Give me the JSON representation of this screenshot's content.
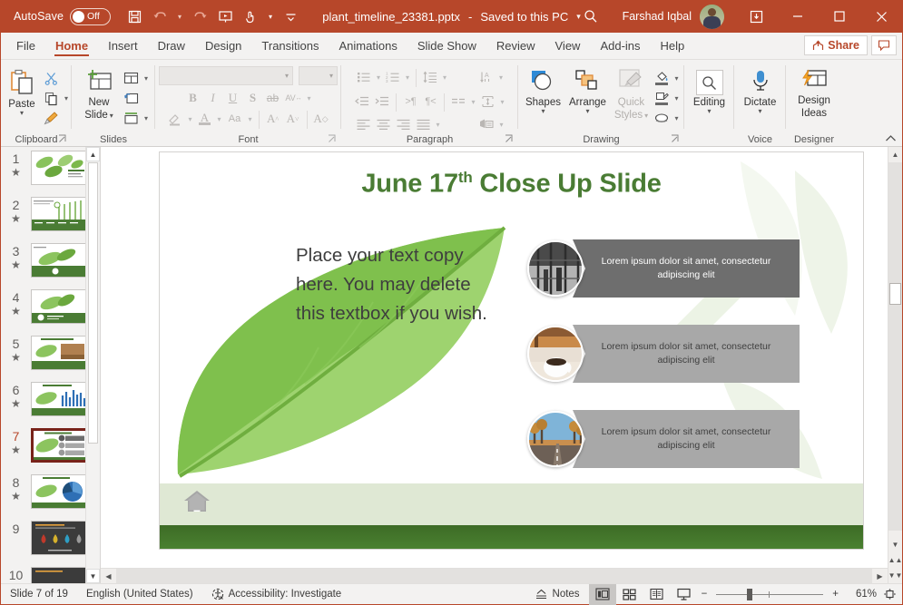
{
  "titlebar": {
    "autosave_label": "AutoSave",
    "autosave_state": "Off",
    "filename": "plant_timeline_23381.pptx",
    "saved_status": "Saved to this PC",
    "caret": "▾",
    "user_name": "Farshad Iqbal",
    "quick_access": [
      "save-icon",
      "undo-icon",
      "redo-icon",
      "start-presentation-icon",
      "touch-mode-icon",
      "customize-qat-icon"
    ],
    "window_controls": [
      "ribbon-display-options",
      "minimize",
      "maximize",
      "close"
    ]
  },
  "tabs": [
    {
      "label": "File",
      "active": false
    },
    {
      "label": "Home",
      "active": true
    },
    {
      "label": "Insert",
      "active": false
    },
    {
      "label": "Draw",
      "active": false
    },
    {
      "label": "Design",
      "active": false
    },
    {
      "label": "Transitions",
      "active": false
    },
    {
      "label": "Animations",
      "active": false
    },
    {
      "label": "Slide Show",
      "active": false
    },
    {
      "label": "Review",
      "active": false
    },
    {
      "label": "View",
      "active": false
    },
    {
      "label": "Add-ins",
      "active": false
    },
    {
      "label": "Help",
      "active": false
    }
  ],
  "share": {
    "label": "Share",
    "comment_icon": "comment-icon"
  },
  "ribbon": {
    "groups": [
      {
        "name": "Clipboard",
        "label": "Clipboard",
        "paste_label": "Paste",
        "has_launcher": true
      },
      {
        "name": "Slides",
        "label": "Slides",
        "new_slide_label": "New\nSlide",
        "has_launcher": false
      },
      {
        "name": "Font",
        "label": "Font",
        "has_launcher": true
      },
      {
        "name": "Paragraph",
        "label": "Paragraph",
        "has_launcher": true
      },
      {
        "name": "Drawing",
        "label": "Drawing",
        "has_launcher": true
      },
      {
        "name": "Voice",
        "label": "Voice",
        "has_launcher": false
      },
      {
        "name": "Designer",
        "label": "Designer",
        "has_launcher": false
      }
    ],
    "new_slide_line1": "New",
    "new_slide_line2": "Slide",
    "font_name_value": "",
    "font_size_value": "",
    "drawing": {
      "shapes_label": "Shapes",
      "arrange_label": "Arrange",
      "quick_styles_line1": "Quick",
      "quick_styles_line2": "Styles"
    },
    "editing_label": "Editing",
    "dictate_label": "Dictate",
    "design_ideas_line1": "Design",
    "design_ideas_line2": "Ideas",
    "collapse_icon": "chevron-up-icon"
  },
  "thumbnails": {
    "slides": [
      {
        "num": "1",
        "star": "★",
        "selected": false
      },
      {
        "num": "2",
        "star": "★",
        "selected": false
      },
      {
        "num": "3",
        "star": "★",
        "selected": false
      },
      {
        "num": "4",
        "star": "★",
        "selected": false
      },
      {
        "num": "5",
        "star": "★",
        "selected": false
      },
      {
        "num": "6",
        "star": "★",
        "selected": false
      },
      {
        "num": "7",
        "star": "★",
        "selected": true
      },
      {
        "num": "8",
        "star": "★",
        "selected": false
      },
      {
        "num": "9",
        "star": "",
        "selected": false
      },
      {
        "num": "10",
        "star": "",
        "selected": false
      }
    ]
  },
  "slide": {
    "title_main": "June 17",
    "title_sup": "th",
    "title_rest": " Close Up Slide",
    "title_color": "#4a7c34",
    "body_text": "Place your text copy here. You may delete this textbox if you wish.",
    "rows": [
      {
        "text": "Lorem ipsum dolor sit amet, consectetur adipiscing elit",
        "box_color": "#6e6e6e",
        "text_color": "#ffffff",
        "image": "city-window-photo"
      },
      {
        "text": "Lorem ipsum dolor sit amet, consectetur adipiscing elit",
        "box_color": "#a8a8a8",
        "text_color": "#3f3f3f",
        "image": "coffee-cup-photo"
      },
      {
        "text": "Lorem ipsum dolor sit amet, consectetur adipiscing elit",
        "box_color": "#a8a8a8",
        "text_color": "#3f3f3f",
        "image": "road-trees-photo"
      }
    ],
    "home_icon": "home-icon"
  },
  "status": {
    "slide_position": "Slide 7 of 19",
    "language": "English (United States)",
    "accessibility": "Accessibility: Investigate",
    "notes_label": "Notes",
    "zoom_percent": "61%",
    "zoom_minus": "−",
    "zoom_plus": "+",
    "views": [
      "normal-view",
      "slide-sorter-view",
      "reading-view",
      "slide-show-view"
    ],
    "fit_slide": "fit-slide-icon"
  }
}
